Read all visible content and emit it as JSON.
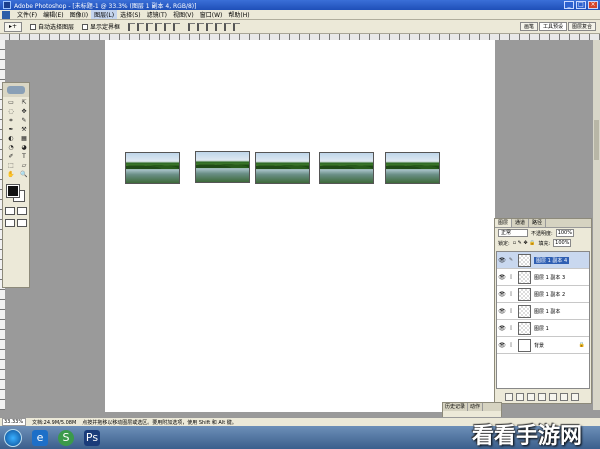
{
  "window": {
    "title": "Adobe Photoshop - [未标题-1 @ 33.3% (图层 1 副本 4, RGB/8)]",
    "buttons": [
      "_",
      "□",
      "×"
    ]
  },
  "menu": [
    "文件(F)",
    "编辑(E)",
    "图像(I)",
    "图层(L)",
    "选择(S)",
    "滤镜(T)",
    "视图(V)",
    "窗口(W)",
    "帮助(H)"
  ],
  "options": {
    "preset": "▸+",
    "auto_select_label": "自动选择图层",
    "show_bounds_label": "显示定界框",
    "wells": [
      "画笔",
      "工具预设",
      "图层复合"
    ]
  },
  "toolbox": {
    "tools": [
      "▭",
      "⇱",
      "◌",
      "✥",
      "⌗",
      "✎",
      "✒",
      "⚒",
      "◐",
      "▦",
      "◔",
      "◕",
      "✐",
      "T",
      "⬚",
      "▱",
      "✋",
      "🔍"
    ]
  },
  "colors": {
    "foreground": "#111111",
    "background": "#ffffff",
    "selection": "#2f5fb3"
  },
  "layers_panel": {
    "tabs": [
      "图层",
      "通道",
      "路径"
    ],
    "blend_mode": "正常",
    "opacity_label": "不透明度:",
    "opacity_value": "100%",
    "lock_label": "锁定:",
    "fill_label": "填充:",
    "fill_value": "100%",
    "layers": [
      {
        "name": "图层 1 副本 4",
        "selected": true,
        "thumb": "transparent"
      },
      {
        "name": "图层 1 副本 3",
        "selected": false,
        "thumb": "transparent"
      },
      {
        "name": "图层 1 副本 2",
        "selected": false,
        "thumb": "transparent"
      },
      {
        "name": "图层 1 副本",
        "selected": false,
        "thumb": "transparent"
      },
      {
        "name": "图层 1",
        "selected": false,
        "thumb": "transparent"
      },
      {
        "name": "背景",
        "selected": false,
        "thumb": "white",
        "locked": true
      }
    ]
  },
  "history_panel": {
    "tabs": [
      "历史记录",
      "动作"
    ]
  },
  "status": {
    "zoom": "33.33%",
    "doc": "文档:24.9M/5.08M",
    "hint": "点按并拖移以移动图层或选区。要用附加选项，使用 Shift 和 Alt 键。"
  },
  "taskbar": [
    "e",
    "S",
    "Ps"
  ],
  "watermark": "看看手游网"
}
